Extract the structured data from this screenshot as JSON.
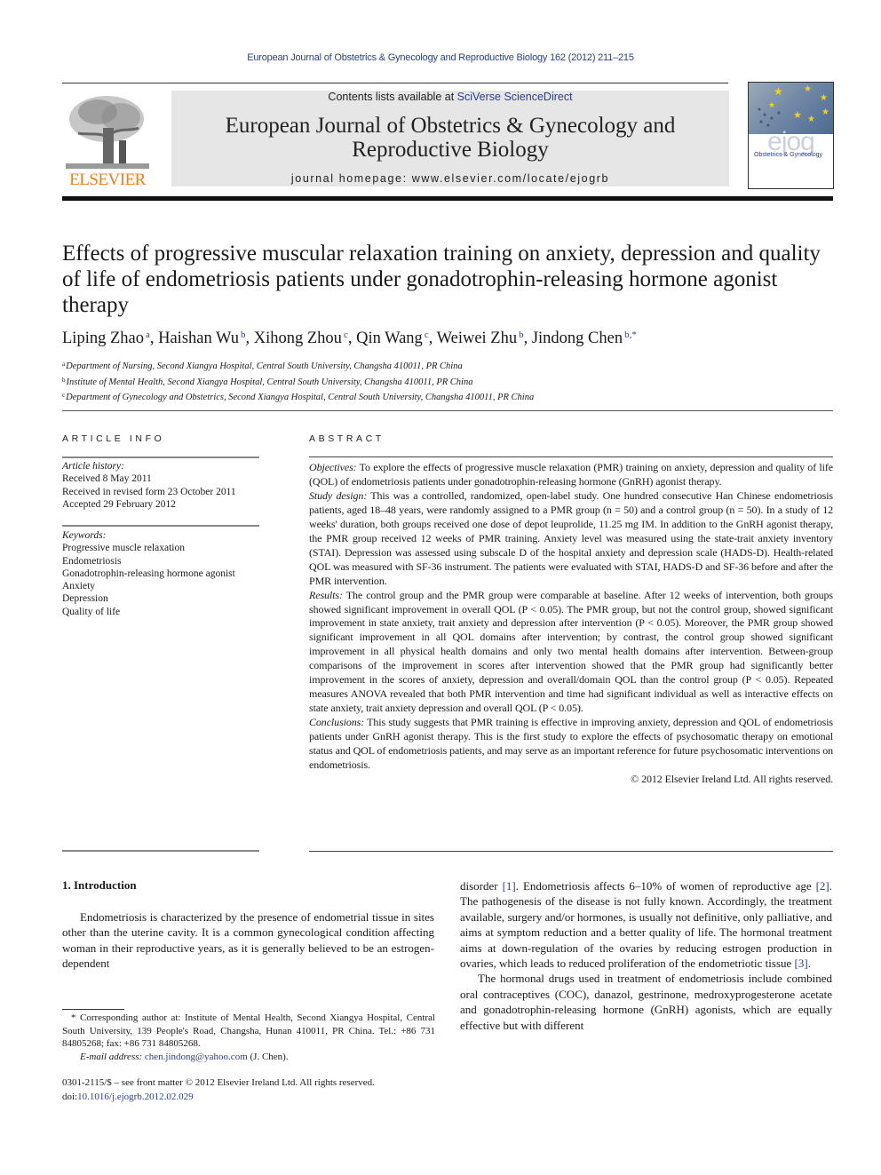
{
  "header": {
    "citation": "European Journal of Obstetrics & Gynecology and Reproductive Biology 162 (2012) 211–215",
    "contents_prefix": "Contents lists available at ",
    "contents_link": "SciVerse ScienceDirect",
    "journal_title_line1": "European Journal of Obstetrics & Gynecology and",
    "journal_title_line2": "Reproductive Biology",
    "homepage": "journal homepage: www.elsevier.com/locate/ejogrb",
    "publisher_logo_text": "ELSEVIER",
    "cover_logo_text": "ejog",
    "cover_subtitle": "Obstetrics & Gynecology",
    "colors": {
      "link": "#2b3e8c",
      "elsevier_orange": "#f07f1b",
      "banner_bg": "#e6e6e6"
    }
  },
  "article": {
    "title": "Effects of progressive muscular relaxation training on anxiety, depression and quality of life of endometriosis patients under gonadotrophin-releasing hormone agonist therapy",
    "authors": [
      {
        "name": "Liping Zhao",
        "aff": "a",
        "sep": ", "
      },
      {
        "name": "Haishan Wu",
        "aff": "b",
        "sep": ", "
      },
      {
        "name": "Xihong Zhou",
        "aff": "c",
        "sep": ", "
      },
      {
        "name": "Qin Wang",
        "aff": "c",
        "sep": ", "
      },
      {
        "name": "Weiwei Zhu",
        "aff": "b",
        "sep": ", "
      },
      {
        "name": "Jindong Chen",
        "aff": "b,*",
        "sep": ""
      }
    ],
    "affiliations": [
      {
        "key": "a",
        "text": "Department of Nursing, Second Xiangya Hospital, Central South University, Changsha 410011, PR China"
      },
      {
        "key": "b",
        "text": "Institute of Mental Health, Second Xiangya Hospital, Central South University, Changsha 410011, PR China"
      },
      {
        "key": "c",
        "text": "Department of Gynecology and Obstetrics, Second Xiangya Hospital, Central South University, Changsha 410011, PR China"
      }
    ]
  },
  "article_info": {
    "caption": "ARTICLE INFO",
    "history_label": "Article history:",
    "history": [
      "Received 8 May 2011",
      "Received in revised form 23 October 2011",
      "Accepted 29 February 2012"
    ],
    "keywords_label": "Keywords:",
    "keywords": [
      "Progressive muscle relaxation",
      "Endometriosis",
      "Gonadotrophin-releasing hormone agonist",
      "Anxiety",
      "Depression",
      "Quality of life"
    ]
  },
  "abstract": {
    "caption": "ABSTRACT",
    "sections": [
      {
        "label": "Objectives:",
        "text": " To explore the effects of progressive muscle relaxation (PMR) training on anxiety, depression and quality of life (QOL) of endometriosis patients under gonadotrophin-releasing hormone (GnRH) agonist therapy."
      },
      {
        "label": "Study design:",
        "text": " This was a controlled, randomized, open-label study. One hundred consecutive Han Chinese endometriosis patients, aged 18–48 years, were randomly assigned to a PMR group (n = 50) and a control group (n = 50). In a study of 12 weeks' duration, both groups received one dose of depot leuprolide, 11.25 mg IM. In addition to the GnRH agonist therapy, the PMR group received 12 weeks of PMR training. Anxiety level was measured using the state-trait anxiety inventory (STAI). Depression was assessed using subscale D of the hospital anxiety and depression scale (HADS-D). Health-related QOL was measured with SF-36 instrument. The patients were evaluated with STAI, HADS-D and SF-36 before and after the PMR intervention."
      },
      {
        "label": "Results:",
        "text": " The control group and the PMR group were comparable at baseline. After 12 weeks of intervention, both groups showed significant improvement in overall QOL (P < 0.05). The PMR group, but not the control group, showed significant improvement in state anxiety, trait anxiety and depression after intervention (P < 0.05). Moreover, the PMR group showed significant improvement in all QOL domains after intervention; by contrast, the control group showed significant improvement in all physical health domains and only two mental health domains after intervention. Between-group comparisons of the improvement in scores after intervention showed that the PMR group had significantly better improvement in the scores of anxiety, depression and overall/domain QOL than the control group (P < 0.05). Repeated measures ANOVA revealed that both PMR intervention and time had significant individual as well as interactive effects on state anxiety, trait anxiety depression and overall QOL (P < 0.05)."
      },
      {
        "label": "Conclusions:",
        "text": " This study suggests that PMR training is effective in improving anxiety, depression and QOL of endometriosis patients under GnRH agonist therapy. This is the first study to explore the effects of psychosomatic therapy on emotional status and QOL of endometriosis patients, and may serve as an important reference for future psychosomatic interventions on endometriosis."
      }
    ],
    "copyright": "© 2012 Elsevier Ireland Ltd. All rights reserved."
  },
  "body": {
    "intro_heading": "1. Introduction",
    "left_para": "Endometriosis is characterized by the presence of endometrial tissue in sites other than the uterine cavity. It is a common gynecological condition affecting woman in their reproductive years, as it is generally believed to be an estrogen-dependent",
    "right_p1_a": "disorder ",
    "ref1": "[1]",
    "right_p1_b": ". Endometriosis affects 6–10% of women of reproductive age ",
    "ref2": "[2]",
    "right_p1_c": ". The pathogenesis of the disease is not fully known. Accordingly, the treatment available, surgery and/or hormones, is usually not definitive, only palliative, and aims at symptom reduction and a better quality of life. The hormonal treatment aims at down-regulation of the ovaries by reducing estrogen production in ovaries, which leads to reduced proliferation of the endometriotic tissue ",
    "ref3": "[3]",
    "right_p1_d": ".",
    "right_p2": "The hormonal drugs used in treatment of endometriosis include combined oral contraceptives (COC), danazol, gestrinone, medroxyprogesterone acetate and gonadotrophin-releasing hormone (GnRH) agonists, which are equally effective but with different"
  },
  "footnote": {
    "corresponding": "* Corresponding author at: Institute of Mental Health, Second Xiangya Hospital, Central South University, 139 People's Road, Changsha, Hunan 410011, PR China. Tel.: +86 731 84805268; fax: +86 731 84805268.",
    "email_label": "E-mail address:",
    "email": "chen.jindong@yahoo.com",
    "email_suffix": " (J. Chen).",
    "front_matter": "0301-2115/$ – see front matter © 2012 Elsevier Ireland Ltd. All rights reserved.",
    "doi_prefix": "doi:",
    "doi": "10.1016/j.ejogrb.2012.02.029"
  }
}
